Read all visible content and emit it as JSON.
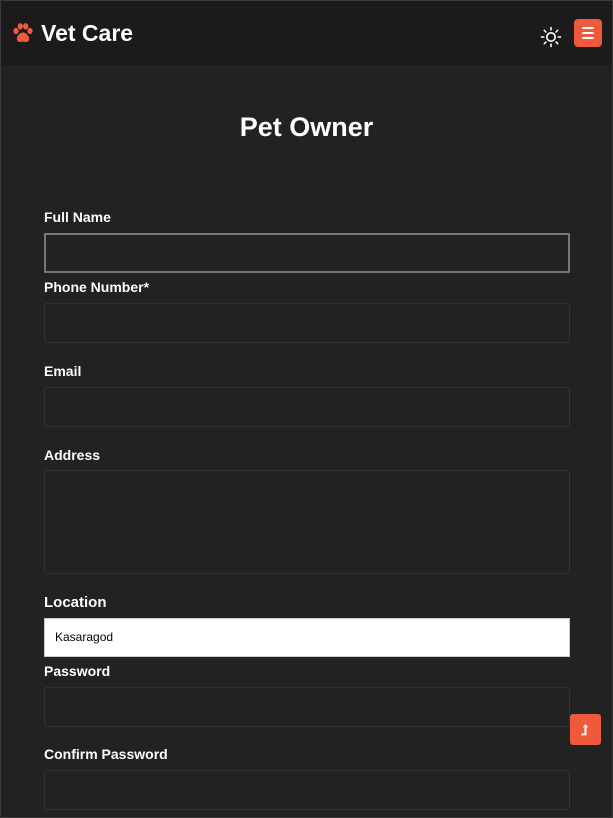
{
  "nav": {
    "brand": "Vet Care",
    "brand_icon": "paw-icon",
    "theme_icon": "sun-icon",
    "menu_icon": "hamburger-menu-icon",
    "accent_color": "#f05a3c"
  },
  "page": {
    "title": "Pet Owner"
  },
  "form": {
    "full_name": {
      "label": "Full Name",
      "value": ""
    },
    "phone": {
      "label": "Phone Number*",
      "value": ""
    },
    "email": {
      "label": "Email",
      "value": ""
    },
    "address": {
      "label": "Address",
      "value": ""
    },
    "location": {
      "label": "Location",
      "value": "Kasaragod"
    },
    "password": {
      "label": "Password",
      "value": ""
    },
    "confirm_password": {
      "label": "Confirm Password",
      "value": ""
    }
  },
  "scroll_top": {
    "icon": "arrow-up-icon"
  }
}
